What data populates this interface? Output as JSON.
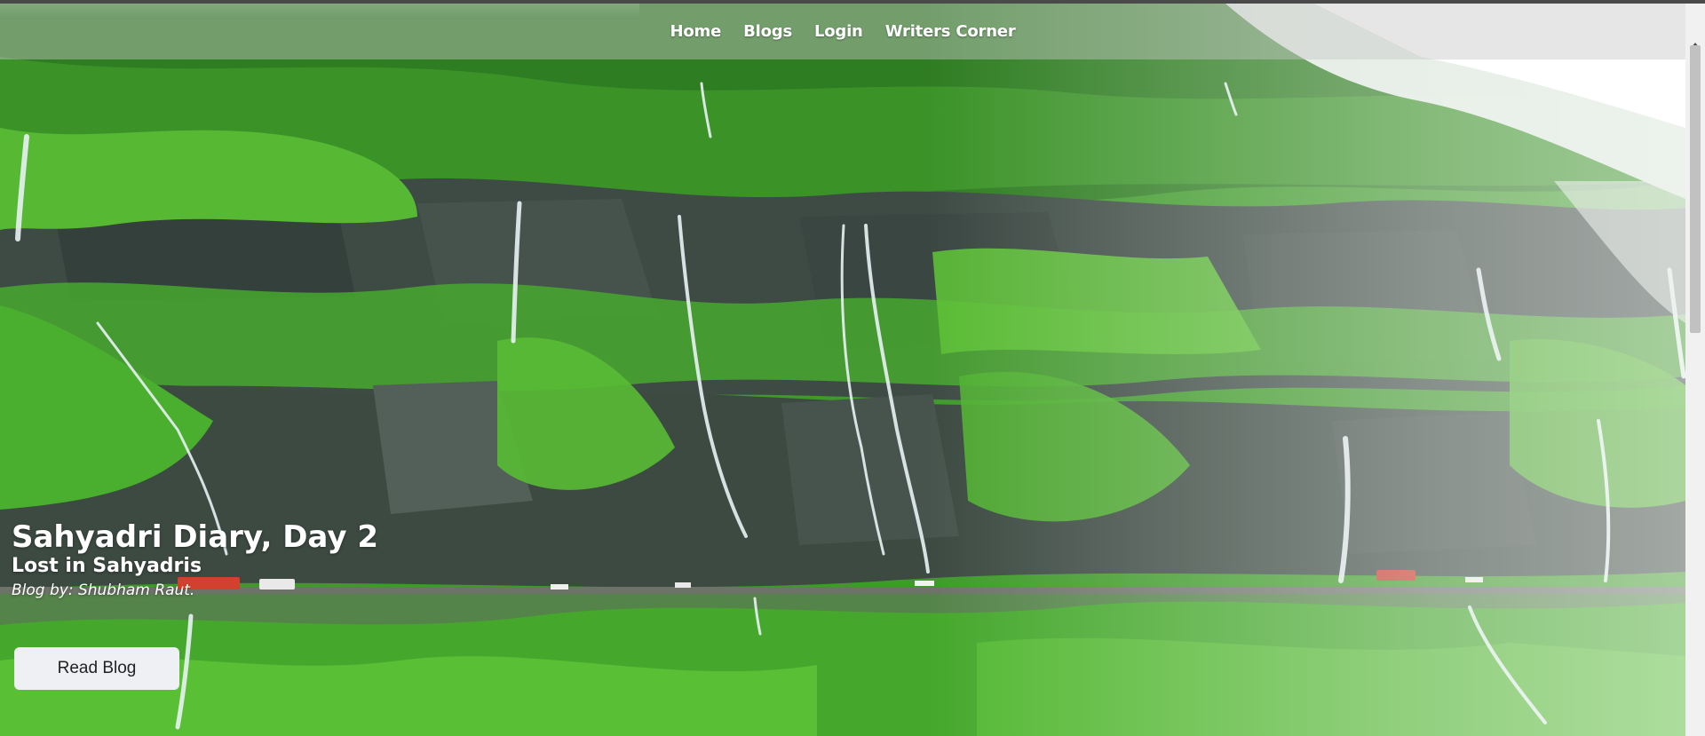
{
  "nav": {
    "links": [
      "Home",
      "Blogs",
      "Login",
      "Writers Corner"
    ]
  },
  "hero": {
    "title": "Sahyadri Diary, Day 2",
    "subtitle": "Lost in Sahyadris",
    "author": "Blog by: Shubham Raut.",
    "cta_label": "Read Blog",
    "background": "green cliffs with waterfalls and mist"
  },
  "colors": {
    "nav_overlay": "rgba(200,200,200,0.45)",
    "button_bg": "#eef0f3",
    "text_on_hero": "#ffffff",
    "foliage": "#3fae28",
    "rock": "#3d4a44"
  },
  "scrollbar": {
    "icon": "scroll-up-arrow-icon"
  }
}
